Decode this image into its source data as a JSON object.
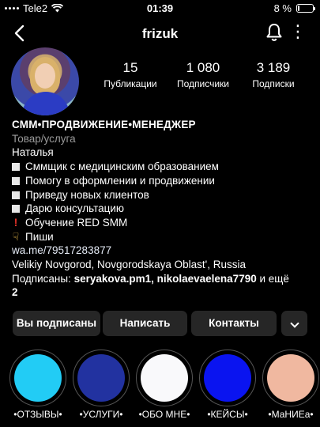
{
  "status_bar": {
    "carrier": "Tele2",
    "time": "01:39",
    "battery": "8 %",
    "battery_level": 0.08
  },
  "nav": {
    "username": "frizuk"
  },
  "stats": [
    {
      "value": "15",
      "label": "Публикации"
    },
    {
      "value": "1 080",
      "label": "Подписчики"
    },
    {
      "value": "3 189",
      "label": "Подписки"
    }
  ],
  "bio": {
    "title": "СММ•ПРОДВИЖЕНИЕ•МЕНЕДЖЕР",
    "category": "Товар/услуга",
    "name": "Наталья",
    "items": [
      "Сммщик с медицинским образованием",
      "Помогу в оформлении и продвижении",
      "Приведу новых клиентов",
      "Дарю консультацию"
    ],
    "training": "Обучение RED SMM",
    "write": "Пиши",
    "link": "wa.me/79517283877",
    "location": "Velikiy Novgorod, Novgorodskaya Oblast', Russia",
    "followed_by_prefix": "Подписаны: ",
    "followed_by_names": "seryakova.pm1, nikolaevaelena7790",
    "followed_by_suffix": " и ещё",
    "followed_by_count": "2"
  },
  "buttons": {
    "subscribed": "Вы подписаны",
    "message": "Написать",
    "contacts": "Контакты"
  },
  "highlights": [
    {
      "name": "•ОТЗЫВЫ•",
      "color": "#22ccf5"
    },
    {
      "name": "•УСЛУГИ•",
      "color": "#2232a0"
    },
    {
      "name": "•ОБО МНЕ•",
      "color": "#f9f9fb"
    },
    {
      "name": "•КЕЙСЫ•",
      "color": "#0a14f0"
    },
    {
      "name": "•МаНИЕа•",
      "color": "#f0b8a0"
    }
  ],
  "icons": {
    "back": "chevron-left-icon",
    "bell": "bell-icon",
    "more": "more-icon",
    "wifi": "wifi-icon",
    "battery": "battery-icon",
    "expand": "chevron-down-icon"
  }
}
